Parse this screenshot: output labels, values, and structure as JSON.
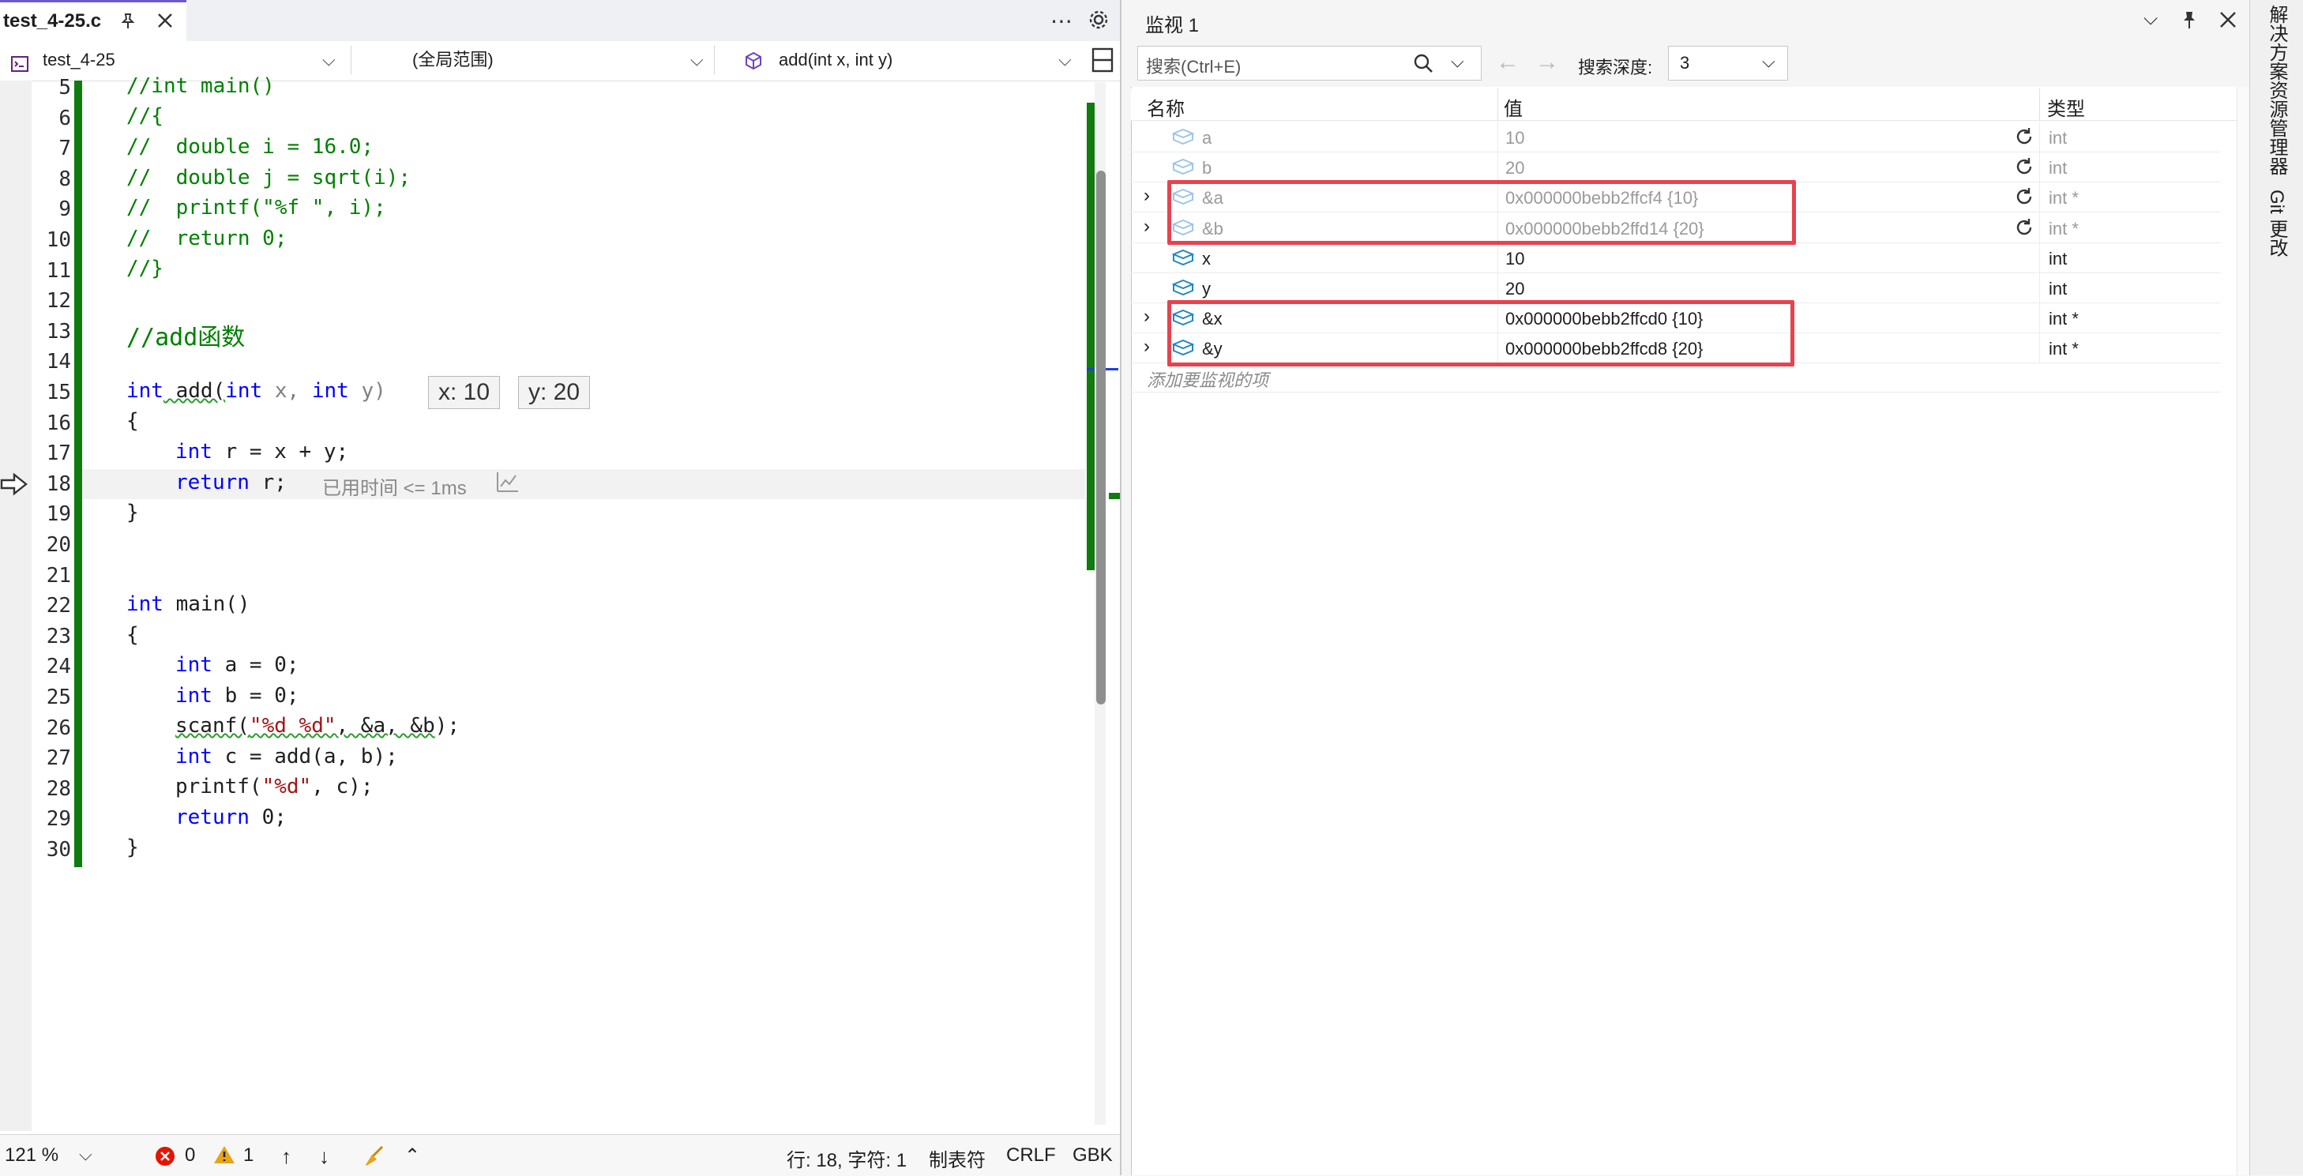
{
  "editor": {
    "tab": {
      "filename": "test_4-25.c"
    },
    "nav": {
      "project": "test_4-25",
      "scope": "(全局范围)",
      "function": "add(int x, int y)"
    },
    "line_numbers": [
      "5",
      "6",
      "7",
      "8",
      "9",
      "10",
      "11",
      "12",
      "13",
      "14",
      "15",
      "16",
      "17",
      "18",
      "19",
      "20",
      "21",
      "22",
      "23",
      "24",
      "25",
      "26",
      "27",
      "28",
      "29",
      "30"
    ],
    "code": {
      "l5": "//int main()",
      "l6": "//{",
      "l7": "//  double i = 16.0;",
      "l8": "//  double j = sqrt(i);",
      "l9": "//  printf(\"%f \", i);",
      "l10": "//  return 0;",
      "l11": "//}",
      "l13": "//add函数",
      "l15_kw1": "int",
      "l15_fn": " add(",
      "l15_kw2": "int",
      "l15_p1": " x, ",
      "l15_kw3": "int",
      "l15_p2": " y)",
      "l16": "{",
      "l17_kw": "int",
      "l17_rest": " r = x + y;",
      "l18_kw": "return",
      "l18_rest": " r;",
      "l19": "}",
      "l22_kw": "int",
      "l22_rest": " main()",
      "l23": "{",
      "l24_kw": "int",
      "l24_rest": " a = 0;",
      "l25_kw": "int",
      "l25_rest": " b = 0;",
      "l26_fn": "scanf(",
      "l26_str": "\"%d %d\"",
      "l26_rest": ", &a, &b",
      "l26_end": ");",
      "l27_kw": "int",
      "l27_rest": " c = add(a, b);",
      "l28_fn": "printf(",
      "l28_str": "\"%d\"",
      "l28_rest": ", c);",
      "l29_kw": "return",
      "l29_rest": " 0;",
      "l30": "}"
    },
    "inline_hints": {
      "x": "x: 10",
      "y": "y: 20"
    },
    "timing": "已用时间 <= 1ms",
    "status": {
      "zoom": "121 %",
      "errors": "0",
      "warnings": "1",
      "position": "行: 18, 字符: 1",
      "indent": "制表符",
      "line_ending": "CRLF",
      "encoding": "GBK"
    }
  },
  "watch": {
    "title": "监视 1",
    "search_placeholder": "搜索(Ctrl+E)",
    "depth_label": "搜索深度:",
    "depth_value": "3",
    "columns": {
      "name": "名称",
      "value": "值",
      "type": "类型"
    },
    "rows": [
      {
        "name": "a",
        "value": "10",
        "type": "int",
        "stale": true,
        "expandable": false
      },
      {
        "name": "b",
        "value": "20",
        "type": "int",
        "stale": true,
        "expandable": false
      },
      {
        "name": "&a",
        "value": "0x000000bebb2ffcf4 {10}",
        "type": "int *",
        "stale": true,
        "expandable": true
      },
      {
        "name": "&b",
        "value": "0x000000bebb2ffd14 {20}",
        "type": "int *",
        "stale": true,
        "expandable": true
      },
      {
        "name": "x",
        "value": "10",
        "type": "int",
        "stale": false,
        "expandable": false
      },
      {
        "name": "y",
        "value": "20",
        "type": "int",
        "stale": false,
        "expandable": false
      },
      {
        "name": "&x",
        "value": "0x000000bebb2ffcd0 {10}",
        "type": "int *",
        "stale": false,
        "expandable": true
      },
      {
        "name": "&y",
        "value": "0x000000bebb2ffcd8 {20}",
        "type": "int *",
        "stale": false,
        "expandable": true
      }
    ],
    "add_item": "添加要监视的项"
  },
  "side_tabs": {
    "solution_explorer": "解决方案资源管理器",
    "git": "Git 更改"
  },
  "colors": {
    "highlight_box": "#e8424e",
    "change_bar": "#107c10",
    "keyword": "#0000ff",
    "comment": "#008000"
  }
}
